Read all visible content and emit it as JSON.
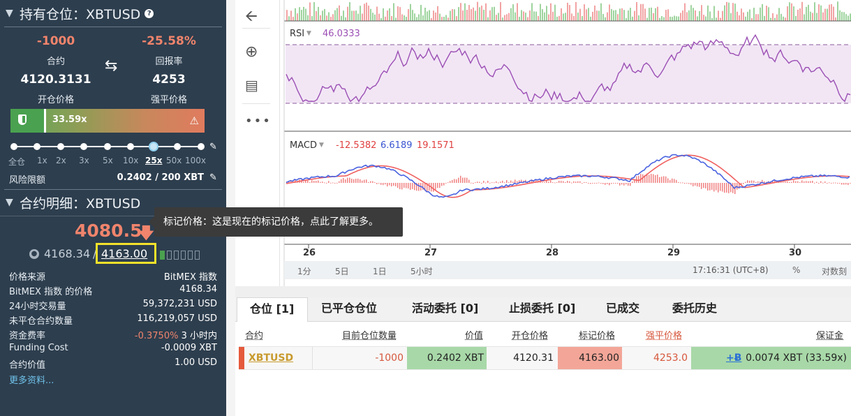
{
  "position_panel": {
    "title": "持有仓位：XBTUSD",
    "contracts_value": "-1000",
    "contracts_label": "合约",
    "roe_value": "-25.58%",
    "roe_label": "回报率",
    "entry_price_value": "4120.3131",
    "entry_price_label": "开仓价格",
    "liq_price_value": "4253",
    "liq_price_label": "强平价格",
    "margin_pct": "33.59x",
    "leverage_options": [
      "全仓",
      "1x",
      "2x",
      "3x",
      "5x",
      "10x",
      "25x",
      "50x",
      "100x"
    ],
    "leverage_selected": "25x",
    "risk_limit_label": "风险限额",
    "risk_limit_value": "0.2402 / 200 XBT"
  },
  "contract_panel": {
    "title": "合约明细：XBTUSD",
    "last_price": "4080.5",
    "index_price": "4168.34",
    "separator": "/",
    "mark_price": "4163.00",
    "rows": [
      {
        "label": "价格来源",
        "value": "BitMEX 指数"
      },
      {
        "label": "BitMEX 指数 的价格",
        "value": "4168.34"
      },
      {
        "label": "24小时交易量",
        "value": "59,372,231 USD"
      },
      {
        "label": "未平仓合约数量",
        "value": "116,219,057 USD"
      },
      {
        "label": "资金费率",
        "value_red": "-0.3750%",
        "value": "3 小时内"
      },
      {
        "label": "Funding Cost",
        "value_red": "-0.0009 XBT"
      },
      {
        "label": "合约价值",
        "value": "1.00 USD"
      }
    ],
    "more_link": "更多资料..."
  },
  "tooltip": {
    "text": "标记价格：这是现在的标记价格，点此了解更多。"
  },
  "chart": {
    "rsi_label": "RSI",
    "rsi_value": "46.0333",
    "macd_label": "MACD",
    "macd_v1": "-12.5382",
    "macd_v2": "6.6189",
    "macd_v3": "19.1571",
    "x_labels": [
      "26",
      "27",
      "28",
      "29",
      "30"
    ],
    "timeframes": [
      "1分",
      "5日",
      "1日",
      "5小时"
    ],
    "clock": "17:16:31 (UTC+8)",
    "pct_button": "%",
    "log_button": "对数刻",
    "colors": {
      "rsi": "#9b4fb4",
      "macd_blue": "#4a63e0",
      "macd_red": "#f06060",
      "rsi_band": "#f2e6f5"
    }
  },
  "bottom": {
    "tabs": [
      "仓位 [1]",
      "已平仓仓位",
      "活动委托 [0]",
      "止损委托 [0]",
      "已成交",
      "委托历史"
    ],
    "headers": [
      "合约",
      "目前仓位数量",
      "价值",
      "开仓价格",
      "标记价格",
      "强平价格",
      "保证金"
    ],
    "row": {
      "symbol": "XBTUSD",
      "size": "-1000",
      "value": "0.2402 XBT",
      "entry": "4120.31",
      "mark": "4163.00",
      "liq": "4253.0",
      "margin_add": "+Ƀ",
      "margin": "0.0074 XBT (33.59x)"
    }
  }
}
